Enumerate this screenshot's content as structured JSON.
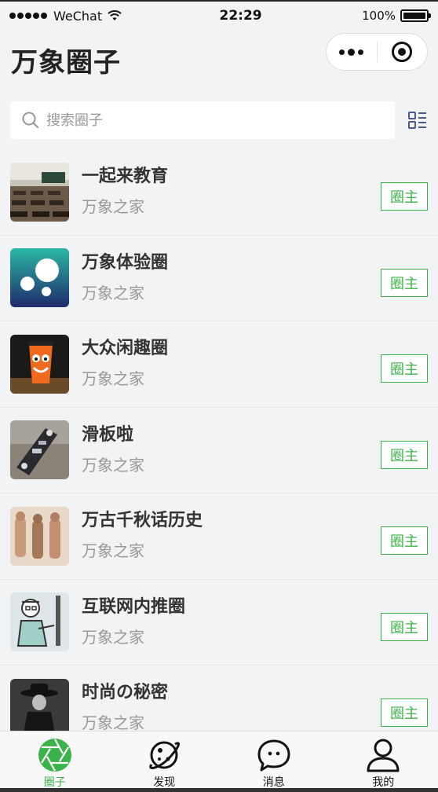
{
  "status_bar": {
    "carrier": "WeChat",
    "time": "22:29",
    "battery": "100%"
  },
  "header": {
    "title": "万象圈子"
  },
  "search": {
    "placeholder": "搜索圈子"
  },
  "circles": [
    {
      "name": "一起来教育",
      "subtitle": "万象之家",
      "badge": "圈主",
      "avatar": "classroom"
    },
    {
      "name": "万象体验圈",
      "subtitle": "万象之家",
      "badge": "圈主",
      "avatar": "bubbles"
    },
    {
      "name": "大众闲趣圈",
      "subtitle": "万象之家",
      "badge": "圈主",
      "avatar": "cup-face"
    },
    {
      "name": "滑板啦",
      "subtitle": "万象之家",
      "badge": "圈主",
      "avatar": "skateboard"
    },
    {
      "name": "万古千秋话历史",
      "subtitle": "万象之家",
      "badge": "圈主",
      "avatar": "terracotta"
    },
    {
      "name": "互联网内推圈",
      "subtitle": "万象之家",
      "badge": "圈主",
      "avatar": "sketch-man"
    },
    {
      "name": "时尚の秘密",
      "subtitle": "万象之家",
      "badge": "圈主",
      "avatar": "fashion"
    }
  ],
  "tabbar": {
    "tabs": [
      {
        "label": "圈子",
        "icon": "aperture-icon",
        "active": true
      },
      {
        "label": "发现",
        "icon": "planet-icon",
        "active": false
      },
      {
        "label": "消息",
        "icon": "chat-bubble-icon",
        "active": false
      },
      {
        "label": "我的",
        "icon": "person-icon",
        "active": false
      }
    ]
  },
  "colors": {
    "accent": "#3cb34a",
    "background": "#f2f3f5"
  }
}
